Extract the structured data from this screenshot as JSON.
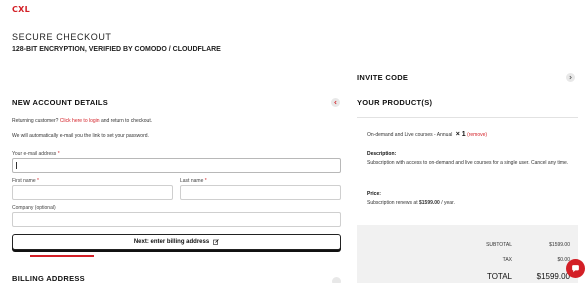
{
  "brand": {
    "logo": "CXL"
  },
  "header": {
    "title": "SECURE CHECKOUT",
    "subtitle": "128-BIT ENCRYPTION, VERIFIED BY COMODO / CLOUDFLARE"
  },
  "account": {
    "heading": "NEW ACCOUNT DETAILS",
    "returning_text": "Returning customer?",
    "login_link": "Click here to login",
    "returning_suffix": "and return to checkout.",
    "email_note": "We will automatically e-mail you the link to set your password.",
    "email_label": "Your e-mail address",
    "first_name_label": "First name",
    "last_name_label": "Last name",
    "company_label": "Company (optional)",
    "required_mark": "*",
    "email_value": "",
    "first_name_value": "",
    "last_name_value": "",
    "company_value": "",
    "next_button": "Next: enter billing address"
  },
  "billing": {
    "heading": "BILLING ADDRESS"
  },
  "invite": {
    "heading": "INVITE CODE"
  },
  "product": {
    "heading": "YOUR PRODUCT(S)",
    "name": "On-demand and Live courses - Annual",
    "times": "× 1",
    "remove": "(remove)",
    "description_heading": "Description:",
    "description": "Subscription with access to on-demand and live courses for a single user. Cancel any time.",
    "price_heading": "Price:",
    "price_prefix": "Subscription renews at",
    "price_amount": "$1599.00",
    "price_suffix": "/ year."
  },
  "totals": {
    "subtotal_label": "SUBTOTAL",
    "subtotal_value": "$1599.00",
    "tax_label": "TAX",
    "tax_value": "$0.00",
    "total_label": "TOTAL",
    "total_value": "$1599.00"
  },
  "colors": {
    "accent": "#d31f26",
    "text": "#1a1a1a",
    "panel": "#f1f1f1"
  },
  "icons": {
    "collapse": "chevron-left-icon",
    "expand": "chevron-right-icon",
    "edit": "edit-icon",
    "chat": "chat-icon"
  }
}
